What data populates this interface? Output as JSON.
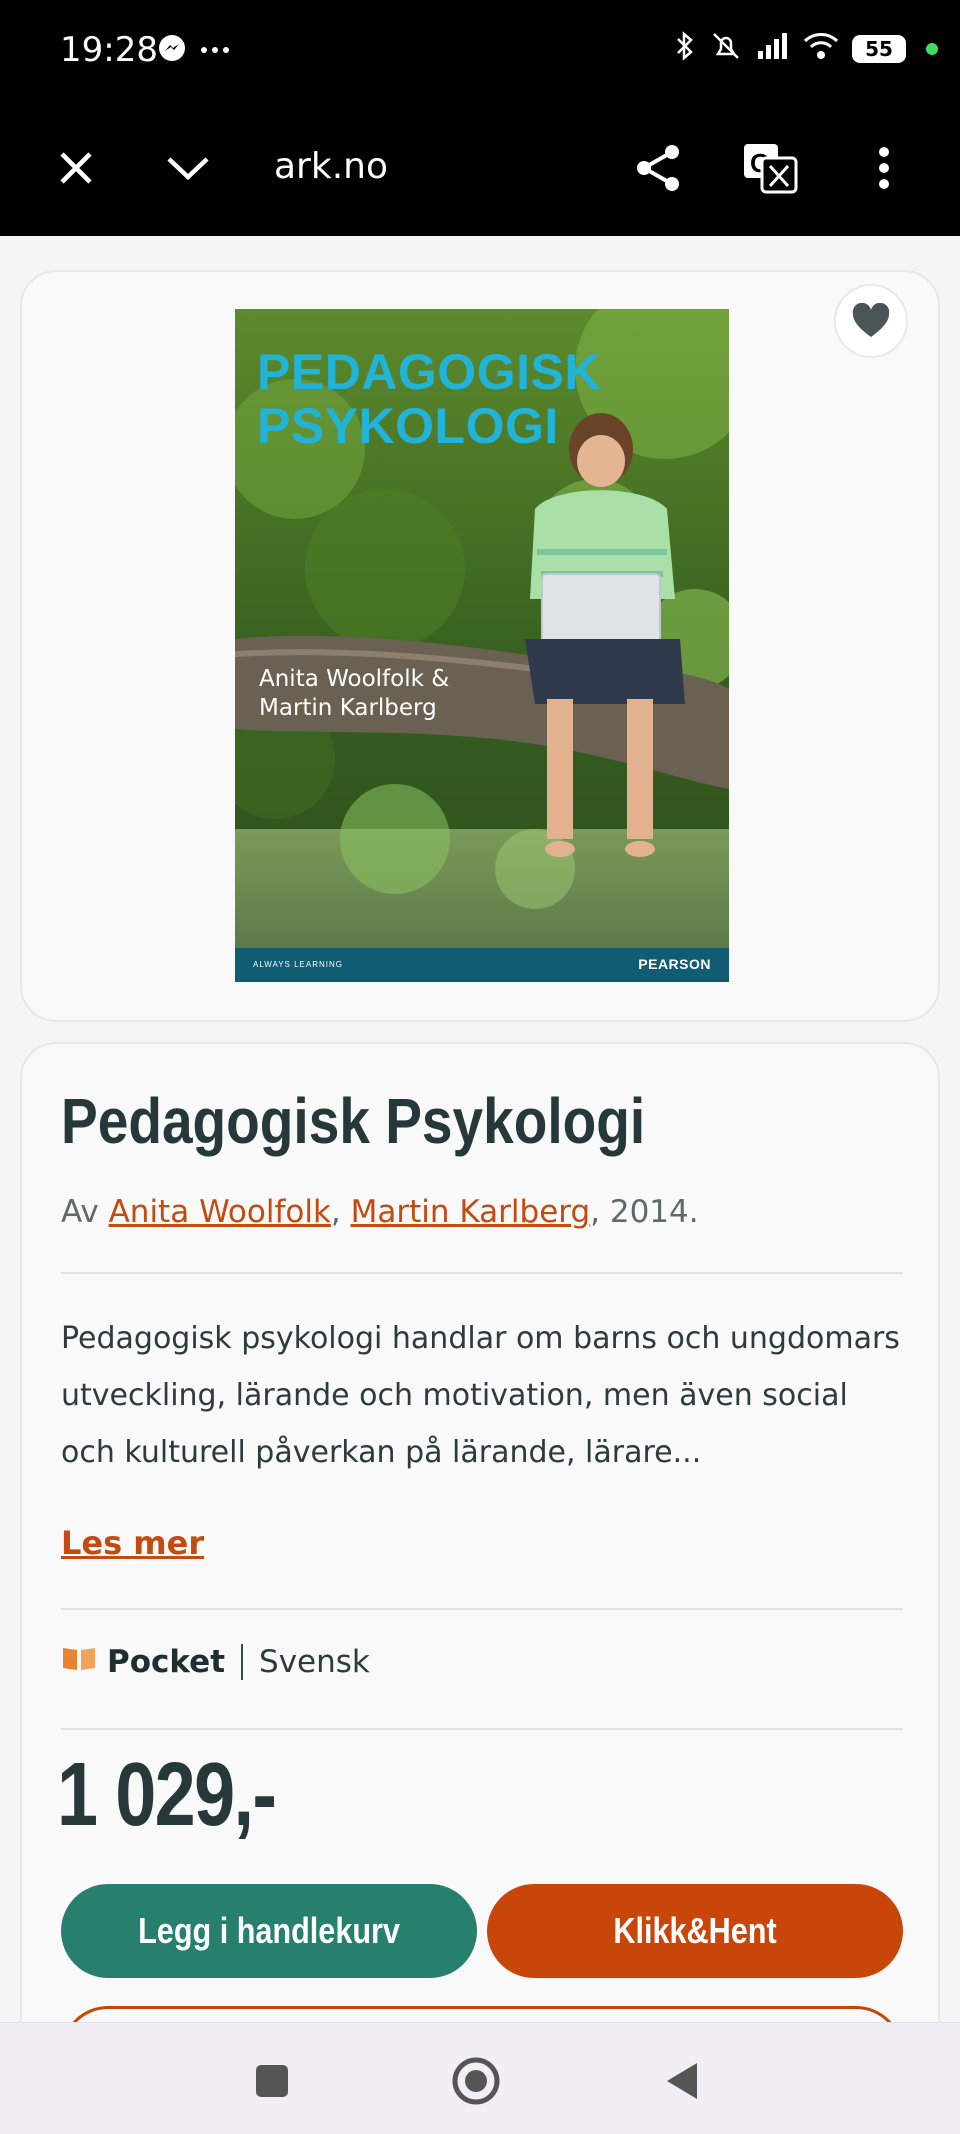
{
  "status_bar": {
    "time": "19:28",
    "battery": "55",
    "icons": [
      "messenger-icon",
      "more-dots-icon",
      "bluetooth-icon",
      "mute-icon",
      "signal-icon",
      "wifi-icon",
      "battery-icon"
    ]
  },
  "browser": {
    "url": "ark.no",
    "icons": [
      "close-icon",
      "chevron-down-icon",
      "share-icon",
      "translate-icon",
      "more-vert-icon"
    ]
  },
  "cover": {
    "title_line1": "PEDAGOGISK",
    "title_line2": "PSYKOLOGI",
    "author_line1": "Anita Woolfolk &",
    "author_line2": "Martin Karlberg",
    "footer_left": "ALWAYS LEARNING",
    "footer_right": "PEARSON"
  },
  "product": {
    "title": "Pedagogisk Psykologi",
    "by_prefix": "Av ",
    "authors": [
      "Anita Woolfolk",
      "Martin Karlberg"
    ],
    "author_sep": ", ",
    "year_suffix": ", 2014.",
    "description": "Pedagogisk psykologi handlar om barns och ungdomars utveckling, lärande och motivation, men även social och kulturell påverkan på lärande, lärare...",
    "read_more": "Les mer",
    "format": "Pocket",
    "language": "Svensk",
    "price": "1 029,-",
    "add_to_cart": "Legg i handlekurv",
    "click_collect": "Klikk&Hent"
  },
  "colors": {
    "accent_orange": "#c9460b",
    "accent_green": "#277f6e",
    "title_text": "#26383a"
  }
}
